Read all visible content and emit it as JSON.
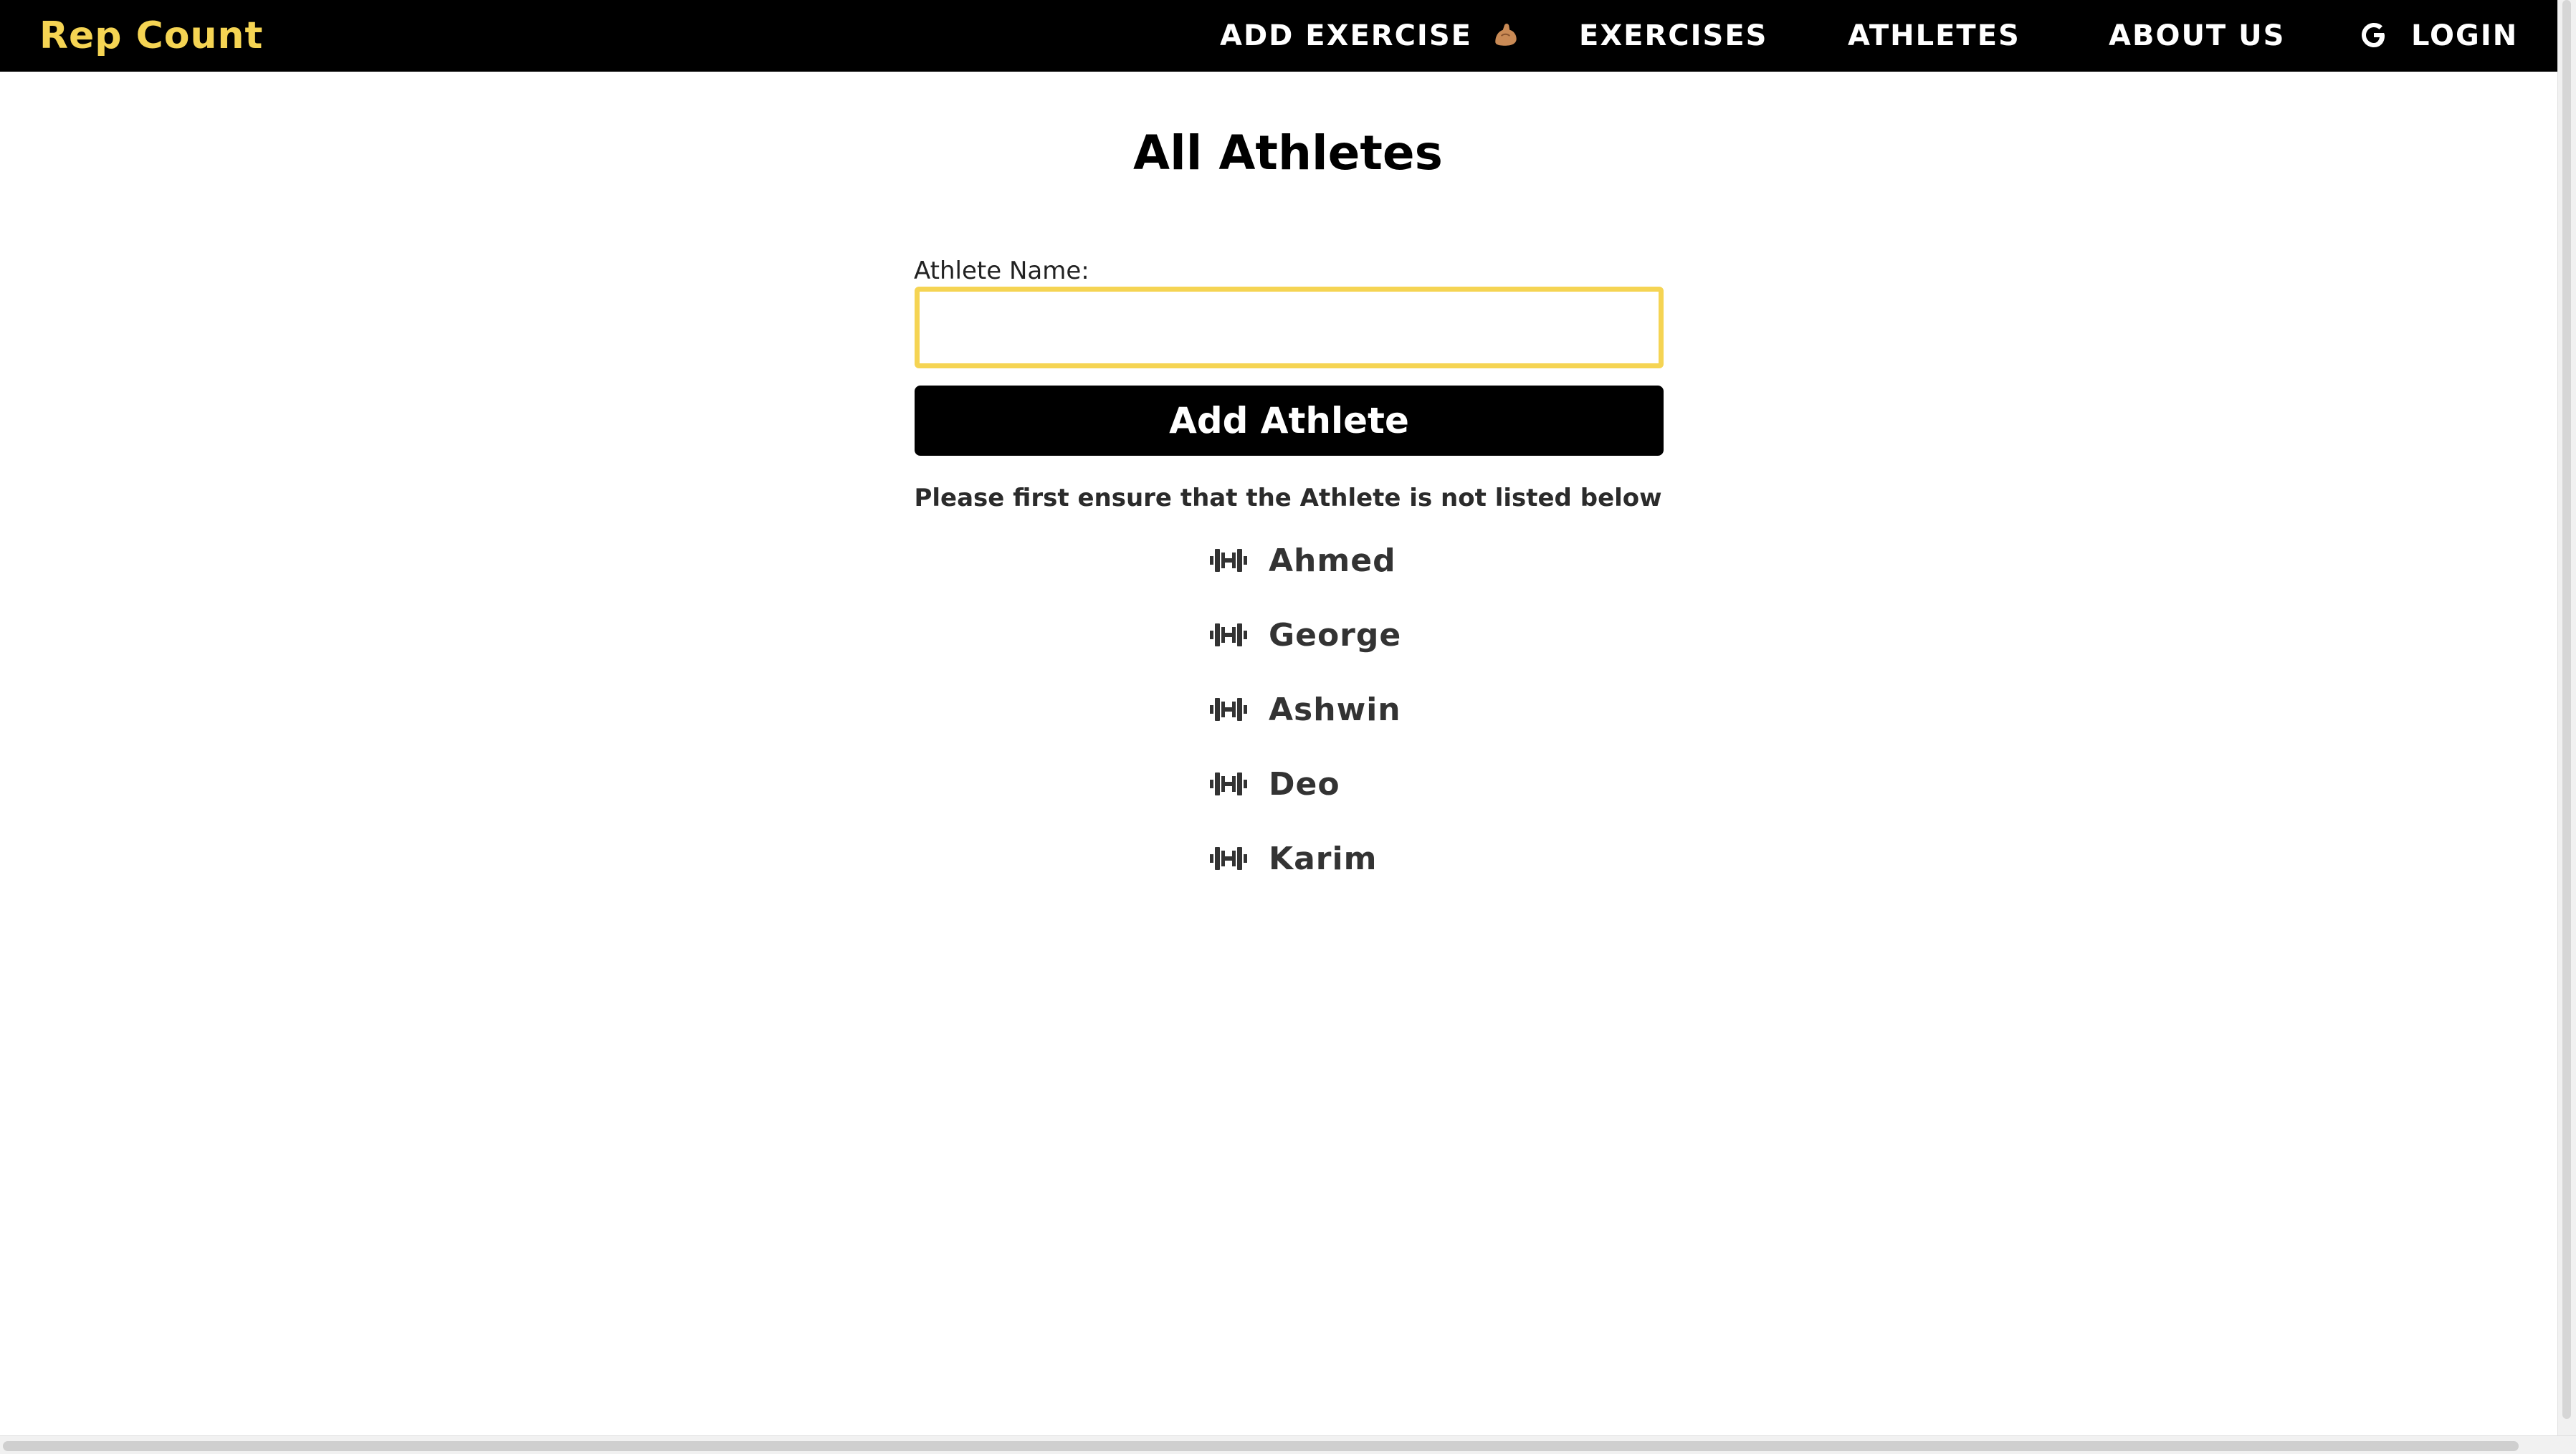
{
  "nav": {
    "brand": "Rep Count",
    "links": {
      "add_exercise": "ADD EXERCISE",
      "exercises": "EXERCISES",
      "athletes": "ATHLETES",
      "about_us": "ABOUT US",
      "login": "LOGIN"
    },
    "brand_color": "#f5d453",
    "icons": {
      "add_exercise": "flexed-biceps-emoji",
      "login": "google-g-icon"
    }
  },
  "main": {
    "title": "All Athletes",
    "form": {
      "label": "Athlete Name:",
      "value": "",
      "button_label": "Add Athlete",
      "input_border_color": "#f5d453"
    },
    "notice": "Please first ensure that the Athlete is not listed below",
    "athletes": [
      "Ahmed",
      "George",
      "Ashwin",
      "Deo",
      "Karim"
    ],
    "list_icon": "dumbbell-icon"
  }
}
